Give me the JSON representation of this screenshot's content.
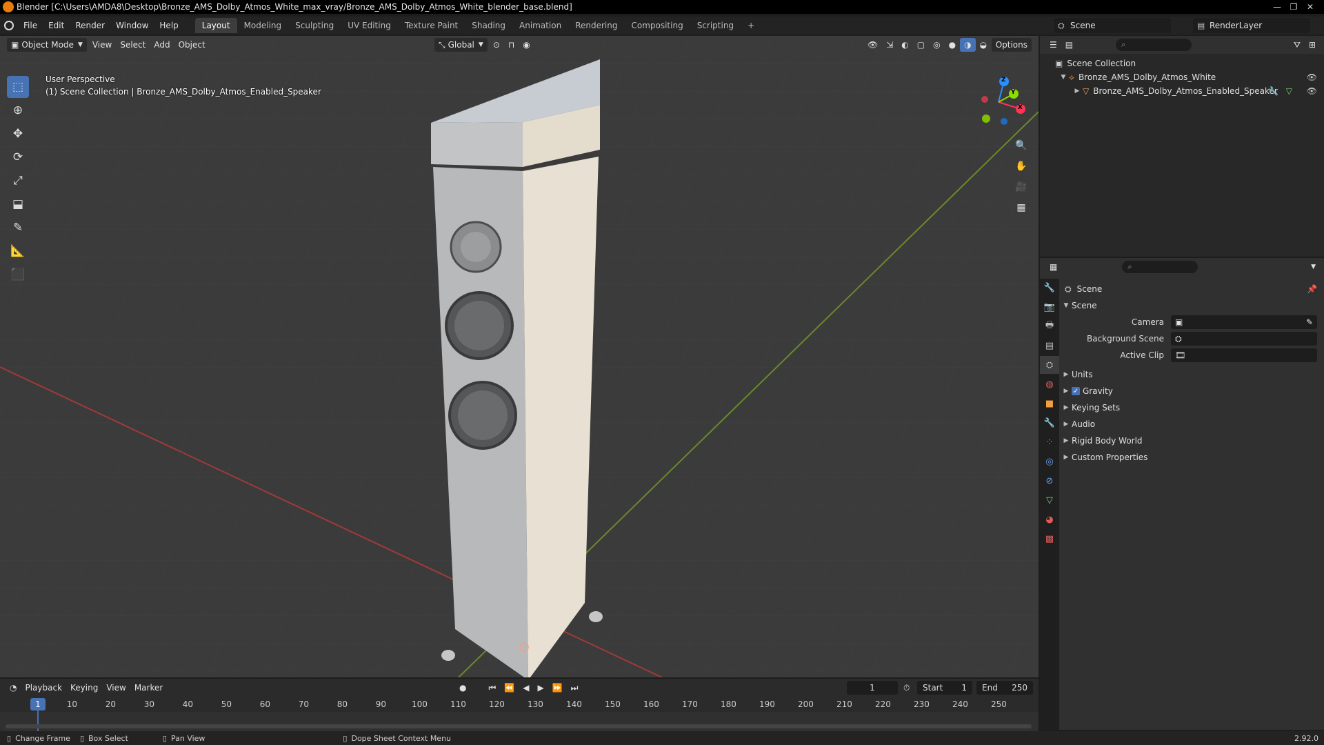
{
  "window": {
    "title": "Blender [C:\\Users\\AMDA8\\Desktop\\Bronze_AMS_Dolby_Atmos_White_max_vray/Bronze_AMS_Dolby_Atmos_White_blender_base.blend]",
    "minimize": "—",
    "maximize": "❐",
    "close": "✕"
  },
  "menu": {
    "file": "File",
    "edit": "Edit",
    "render": "Render",
    "window": "Window",
    "help": "Help"
  },
  "workspaces": [
    "Layout",
    "Modeling",
    "Sculpting",
    "UV Editing",
    "Texture Paint",
    "Shading",
    "Animation",
    "Rendering",
    "Compositing",
    "Scripting"
  ],
  "add_workspace": "+",
  "scene_selector": "Scene",
  "view_layer": "RenderLayer",
  "viewport": {
    "mode": "Object Mode",
    "menus": [
      "View",
      "Select",
      "Add",
      "Object"
    ],
    "transform_orientation": "Global",
    "options": "Options",
    "perspective_label": "User Perspective",
    "collection_label": "(1) Scene Collection | Bronze_AMS_Dolby_Atmos_Enabled_Speaker",
    "gizmo": {
      "x": "X",
      "y": "Y",
      "z": "Z"
    }
  },
  "timeline": {
    "menus": [
      "Playback",
      "Keying",
      "View",
      "Marker"
    ],
    "current_frame": "1",
    "start_label": "Start",
    "start": "1",
    "end_label": "End",
    "end": "250",
    "ticks": [
      "10",
      "20",
      "30",
      "40",
      "50",
      "60",
      "70",
      "80",
      "90",
      "100",
      "110",
      "120",
      "130",
      "140",
      "150",
      "160",
      "170",
      "180",
      "190",
      "200",
      "210",
      "220",
      "230",
      "240",
      "250"
    ],
    "ruler_current": "1"
  },
  "statusbar": {
    "change_frame": "Change Frame",
    "box_select": "Box Select",
    "pan_view": "Pan View",
    "context_menu": "Dope Sheet Context Menu",
    "version": "2.92.0"
  },
  "outliner": {
    "root": "Scene Collection",
    "collection": "Bronze_AMS_Dolby_Atmos_White",
    "object": "Bronze_AMS_Dolby_Atmos_Enabled_Speaker"
  },
  "properties": {
    "context": "Scene",
    "panel_title": "Scene",
    "camera_label": "Camera",
    "background_scene_label": "Background Scene",
    "active_clip_label": "Active Clip",
    "sections": [
      "Units",
      "Gravity",
      "Keying Sets",
      "Audio",
      "Rigid Body World",
      "Custom Properties"
    ],
    "gravity_checked": true
  },
  "colors": {
    "accent": "#4772b3",
    "x_axis": "#ff3352",
    "y_axis": "#8bdc00",
    "z_axis": "#2890ff",
    "background": "#3b3b3b"
  }
}
